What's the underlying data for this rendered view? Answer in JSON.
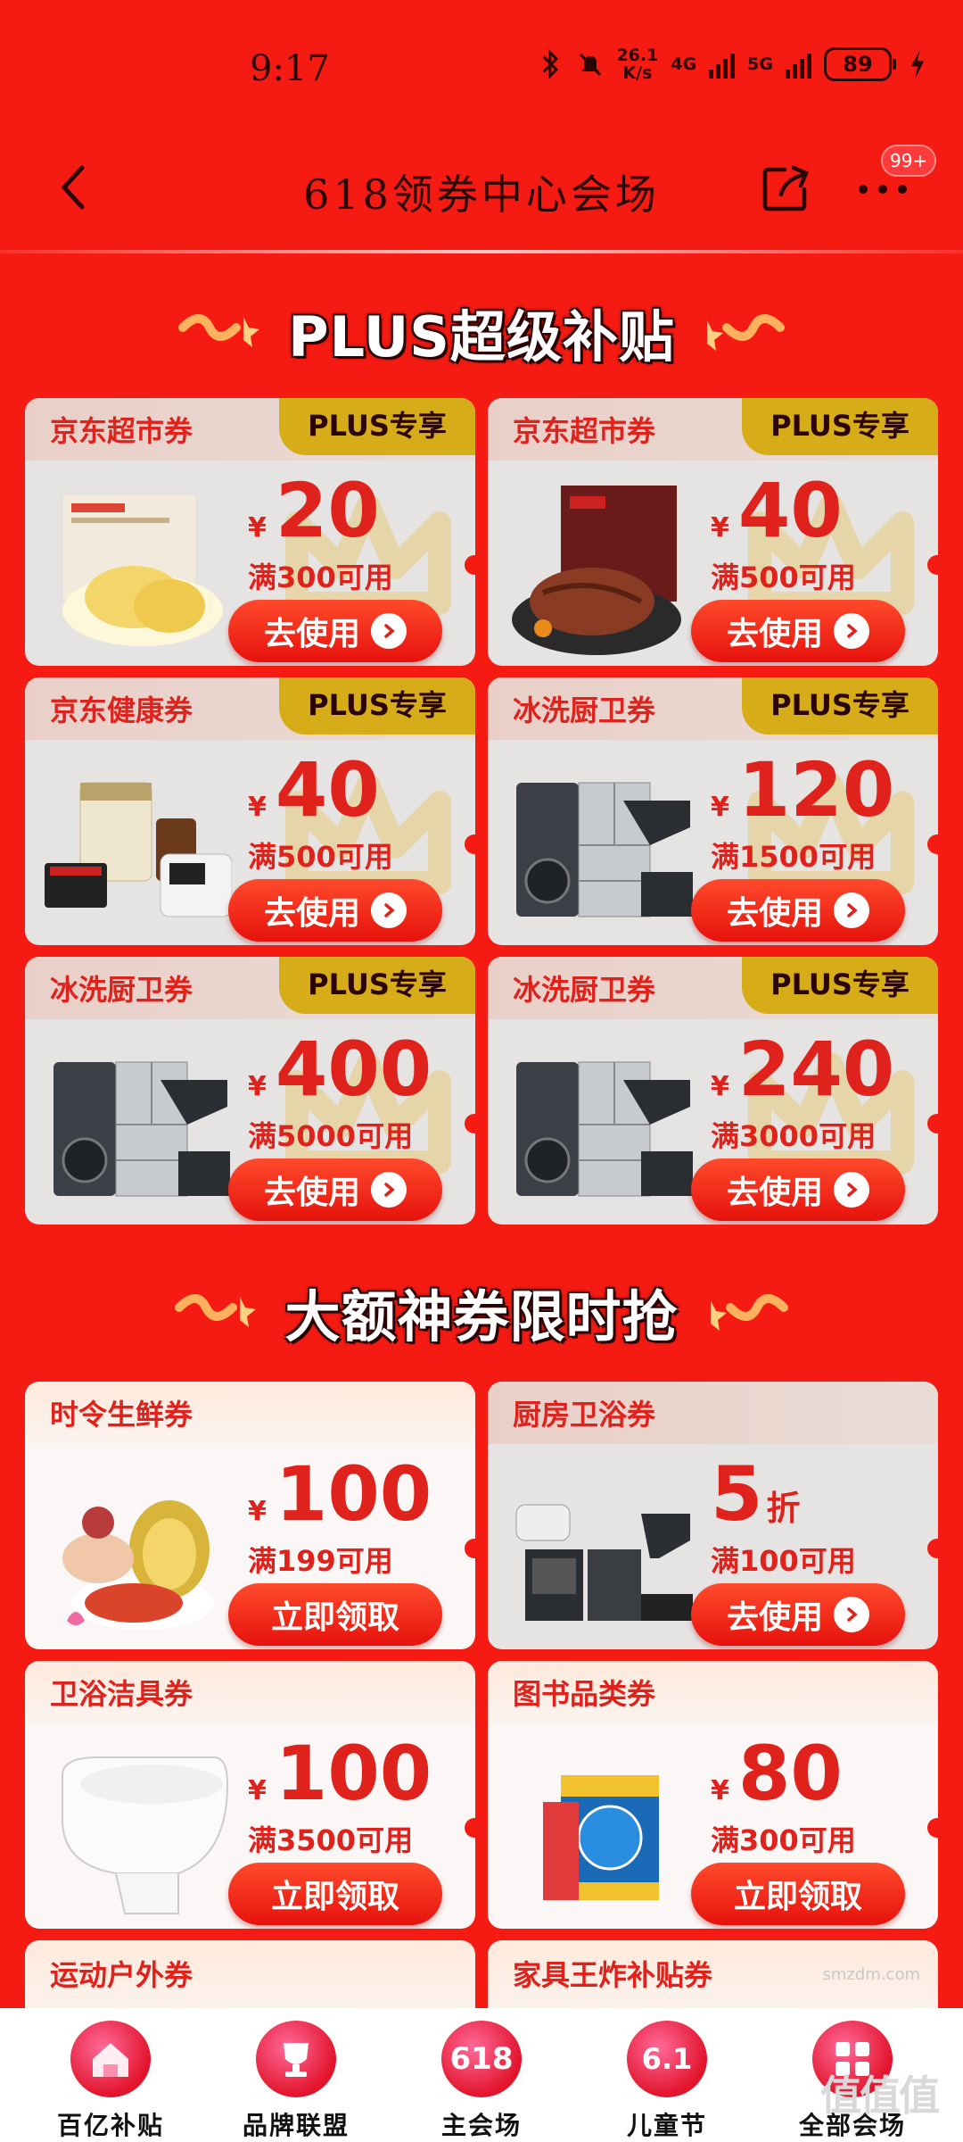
{
  "status_bar": {
    "time": "9:17",
    "speed_top": "26.1",
    "speed_bottom": "K/s",
    "net1": "4G",
    "net2": "5G",
    "battery": "89"
  },
  "nav": {
    "title": "618领券中心会场",
    "badge": "99+"
  },
  "section1": {
    "title": "PLUS超级补贴"
  },
  "section2": {
    "title": "大额神券限时抢"
  },
  "plus_coupons": [
    {
      "name": "京东超市券",
      "tag": "PLUS专享",
      "yen": "¥",
      "amount": "20",
      "condition": "满300可用",
      "button": "去使用",
      "image": "durian-product"
    },
    {
      "name": "京东超市券",
      "tag": "PLUS专享",
      "yen": "¥",
      "amount": "40",
      "condition": "满500可用",
      "button": "去使用",
      "image": "steak-product"
    },
    {
      "name": "京东健康券",
      "tag": "PLUS专享",
      "yen": "¥",
      "amount": "40",
      "condition": "满500可用",
      "button": "去使用",
      "image": "health-products"
    },
    {
      "name": "冰洗厨卫券",
      "tag": "PLUS专享",
      "yen": "¥",
      "amount": "120",
      "condition": "满1500可用",
      "button": "去使用",
      "image": "appliances"
    },
    {
      "name": "冰洗厨卫券",
      "tag": "PLUS专享",
      "yen": "¥",
      "amount": "400",
      "condition": "满5000可用",
      "button": "去使用",
      "image": "appliances"
    },
    {
      "name": "冰洗厨卫券",
      "tag": "PLUS专享",
      "yen": "¥",
      "amount": "240",
      "condition": "满3000可用",
      "button": "去使用",
      "image": "appliances"
    }
  ],
  "big_coupons": [
    {
      "name": "时令生鲜券",
      "yen": "¥",
      "amount": "100",
      "unit": "",
      "condition": "满199可用",
      "button": "立即领取",
      "image": "fresh-food"
    },
    {
      "name": "厨房卫浴券",
      "yen": "",
      "amount": "5",
      "unit": "折",
      "condition": "满100可用",
      "button": "去使用",
      "image": "kitchen-appliances"
    },
    {
      "name": "卫浴洁具券",
      "yen": "¥",
      "amount": "100",
      "unit": "",
      "condition": "满3500可用",
      "button": "立即领取",
      "image": "smart-toilet"
    },
    {
      "name": "图书品类券",
      "yen": "¥",
      "amount": "80",
      "unit": "",
      "condition": "满300可用",
      "button": "立即领取",
      "image": "books"
    }
  ],
  "partial_cards": [
    {
      "name": "运动户外券"
    },
    {
      "name": "家具王炸补贴券"
    }
  ],
  "tabs": [
    {
      "label": "百亿补贴",
      "icon": "house-icon",
      "text": ""
    },
    {
      "label": "品牌联盟",
      "icon": "trophy-icon",
      "text": ""
    },
    {
      "label": "主会场",
      "icon": "618-icon",
      "text": "618"
    },
    {
      "label": "儿童节",
      "icon": "61-icon",
      "text": "6.1"
    },
    {
      "label": "全部会场",
      "icon": "grid-icon",
      "text": ""
    }
  ],
  "watermark": "值值值",
  "watermark_url": "smzdm.com",
  "colors": {
    "background": "#f51b12",
    "accent": "#e0221c",
    "plus_tag": "#d6ad18"
  }
}
